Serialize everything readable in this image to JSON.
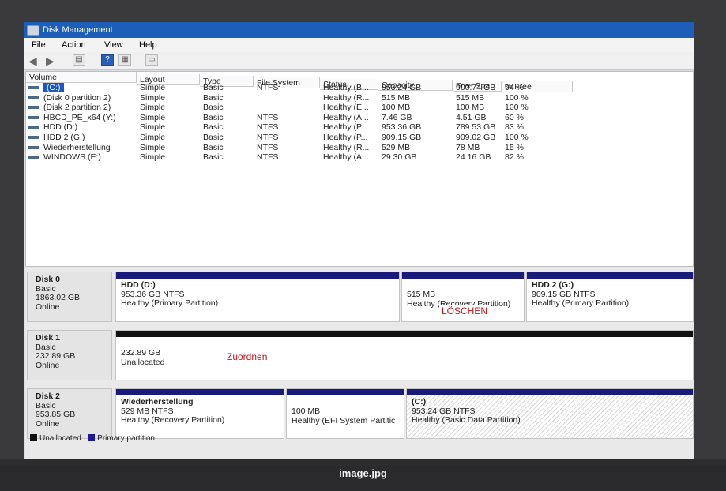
{
  "window": {
    "title": "Disk Management"
  },
  "menu": [
    "File",
    "Action",
    "View",
    "Help"
  ],
  "volume_table": {
    "columns": [
      "Volume",
      "Layout",
      "Type",
      "File System",
      "Status",
      "Capacity",
      "Free Spa...",
      "% Free"
    ],
    "rows": [
      [
        "(C:)",
        "Simple",
        "Basic",
        "NTFS",
        "Healthy (B...",
        "953.24 GB",
        "900.74 GB",
        "94 %"
      ],
      [
        "(Disk 0 partition 2)",
        "Simple",
        "Basic",
        "",
        "Healthy (R...",
        "515 MB",
        "515 MB",
        "100 %"
      ],
      [
        "(Disk 2 partition 2)",
        "Simple",
        "Basic",
        "",
        "Healthy (E...",
        "100 MB",
        "100 MB",
        "100 %"
      ],
      [
        "HBCD_PE_x64 (Y:)",
        "Simple",
        "Basic",
        "NTFS",
        "Healthy (A...",
        "7.46 GB",
        "4.51 GB",
        "60 %"
      ],
      [
        "HDD (D:)",
        "Simple",
        "Basic",
        "NTFS",
        "Healthy (P...",
        "953.36 GB",
        "789.53 GB",
        "83 %"
      ],
      [
        "HDD 2 (G:)",
        "Simple",
        "Basic",
        "NTFS",
        "Healthy (P...",
        "909.15 GB",
        "909.02 GB",
        "100 %"
      ],
      [
        "Wiederherstellung",
        "Simple",
        "Basic",
        "NTFS",
        "Healthy (R...",
        "529 MB",
        "78 MB",
        "15 %"
      ],
      [
        "WINDOWS (E:)",
        "Simple",
        "Basic",
        "NTFS",
        "Healthy (A...",
        "29.30 GB",
        "24.16 GB",
        "82 %"
      ]
    ]
  },
  "disks": [
    {
      "name": "Disk 0",
      "type": "Basic",
      "size": "1863.02 GB",
      "state": "Online",
      "partitions": [
        {
          "name": "HDD  (D:)",
          "size": "953.36 GB NTFS",
          "status": "Healthy (Primary Partition)"
        },
        {
          "name": "",
          "size": "515 MB",
          "status": "Healthy (Recovery Partition)"
        },
        {
          "name": "HDD 2  (G:)",
          "size": "909.15 GB NTFS",
          "status": "Healthy (Primary Partition)"
        }
      ]
    },
    {
      "name": "Disk 1",
      "type": "Basic",
      "size": "232.89 GB",
      "state": "Online",
      "partitions": [
        {
          "name": "",
          "size": "232.89 GB",
          "status": "Unallocated"
        }
      ]
    },
    {
      "name": "Disk 2",
      "type": "Basic",
      "size": "953.85 GB",
      "state": "Online",
      "partitions": [
        {
          "name": "Wiederherstellung",
          "size": "529 MB NTFS",
          "status": "Healthy (Recovery Partition)"
        },
        {
          "name": "",
          "size": "100 MB",
          "status": "Healthy (EFI System Partitic"
        },
        {
          "name": "(C:)",
          "size": "953.24 GB NTFS",
          "status": "Healthy (Basic Data Partition)"
        }
      ]
    }
  ],
  "overlays": {
    "delete": "LÖSCHEN",
    "assign": "Zuordnen"
  },
  "legend": {
    "unallocated": "Unallocated",
    "primary": "Primary partition"
  },
  "caption": "image.jpg",
  "colors": {
    "titlebar": "#1d5fb8",
    "primary_bar": "#1a1a7a",
    "unallocated_bar": "#111111",
    "annotation_red": "#c0141a"
  }
}
